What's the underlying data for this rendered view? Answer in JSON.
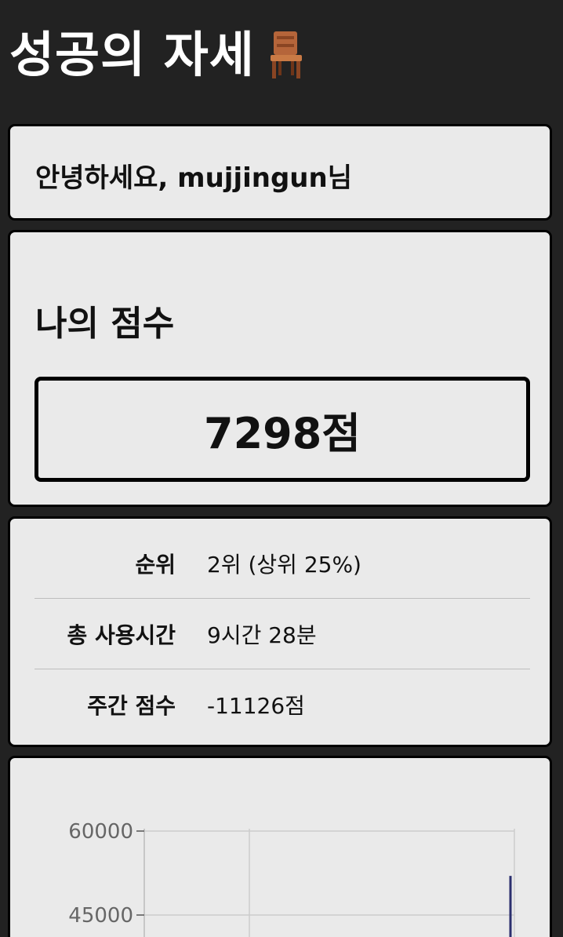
{
  "header": {
    "title": "성공의 자세",
    "icon": "chair-icon"
  },
  "greeting": {
    "text": "안녕하세요, mujjingun님"
  },
  "score": {
    "heading": "나의 점수",
    "value": "7298점"
  },
  "stats": [
    {
      "label": "순위",
      "value": "2위 (상위 25%)"
    },
    {
      "label": "총 사용시간",
      "value": "9시간 28분"
    },
    {
      "label": "주간 점수",
      "value": "-11126점"
    }
  ],
  "chart_data": {
    "type": "line",
    "y_ticks": [
      "60000",
      "45000"
    ],
    "ylim": [
      0,
      60000
    ],
    "grid": true,
    "series": [
      {
        "values": [
          52000
        ]
      }
    ],
    "series_color": "#2b2f6e"
  }
}
